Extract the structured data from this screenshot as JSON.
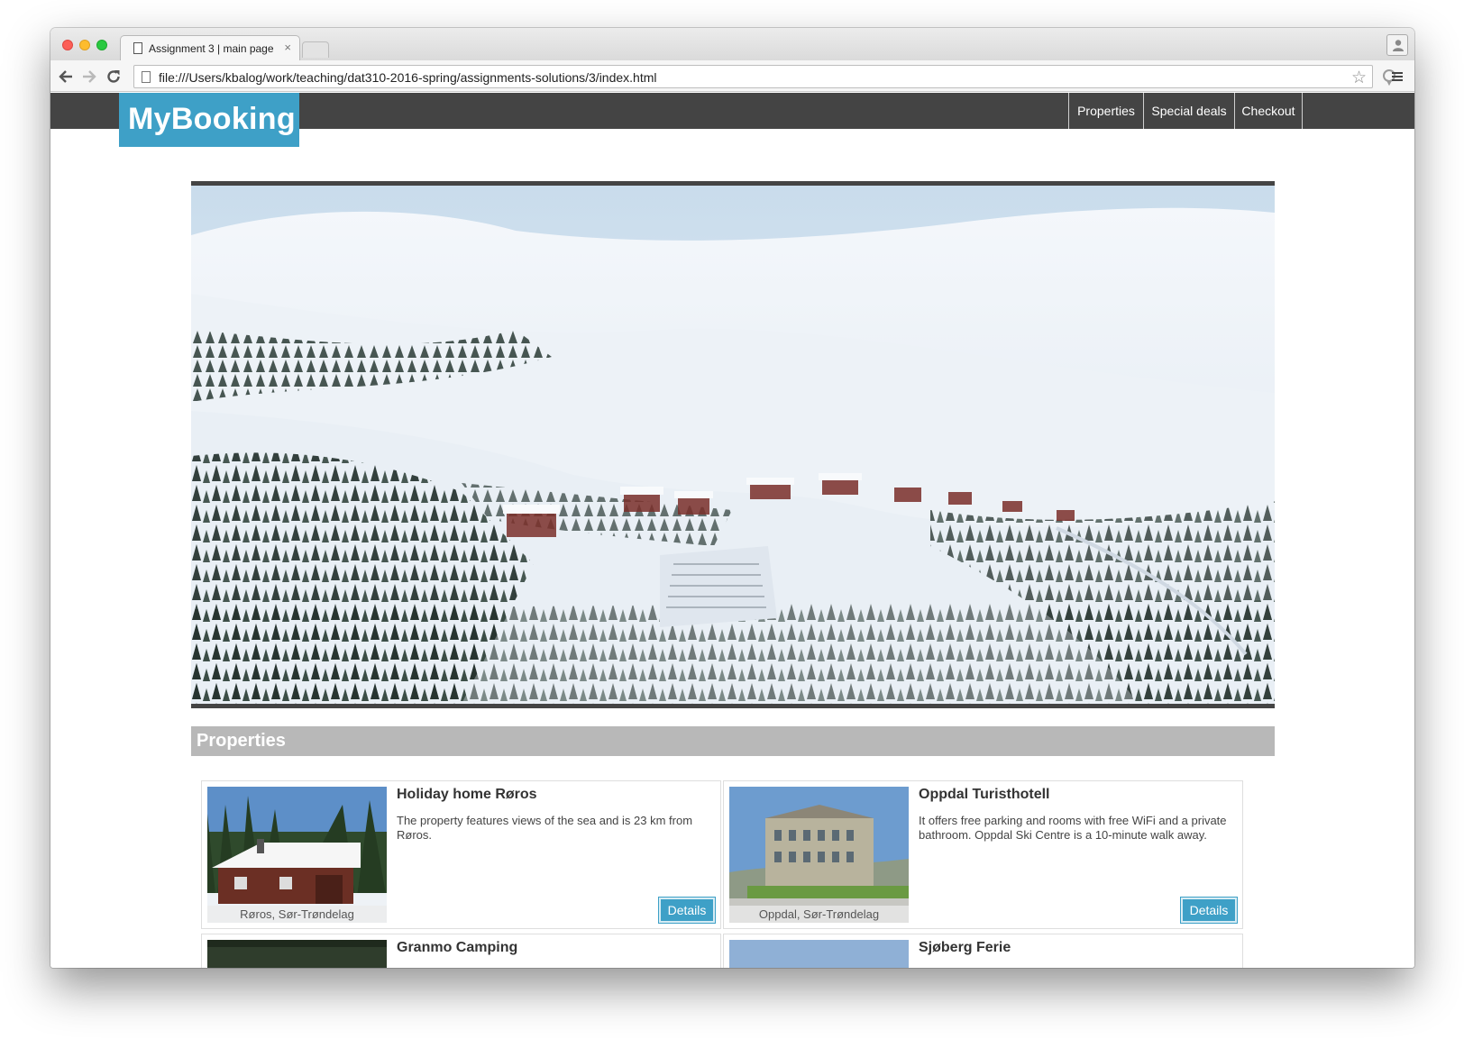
{
  "browser": {
    "tab_title": "Assignment 3 | main page",
    "tab_close": "×",
    "url": "file:///Users/kbalog/work/teaching/dat310-2016-spring/assignments-solutions/3/index.html",
    "icons": [
      "back-icon",
      "forward-icon",
      "reload-icon",
      "page-icon",
      "star-icon",
      "extension-icon",
      "menu-icon",
      "profile-icon"
    ]
  },
  "site": {
    "logo": "MyBooking",
    "nav": [
      "Properties",
      "Special deals",
      "Checkout"
    ],
    "accent_color": "#3ea0c7",
    "nav_color": "#444444"
  },
  "hero": {
    "alt": "Snow-covered ski resort with cabins and forest"
  },
  "section": {
    "title": "Properties"
  },
  "properties": [
    {
      "name": "Holiday home Røros",
      "location": "Røros, Sør-Trøndelag",
      "description": "The property features views of the sea and is 23 km from Røros.",
      "button": "Details"
    },
    {
      "name": "Oppdal Turisthotell",
      "location": "Oppdal, Sør-Trøndelag",
      "description": "It offers free parking and rooms with free WiFi and a private bathroom. Oppdal Ski Centre is a 10-minute walk away.",
      "button": "Details"
    },
    {
      "name": "Granmo Camping"
    },
    {
      "name": "Sjøberg Ferie"
    }
  ]
}
